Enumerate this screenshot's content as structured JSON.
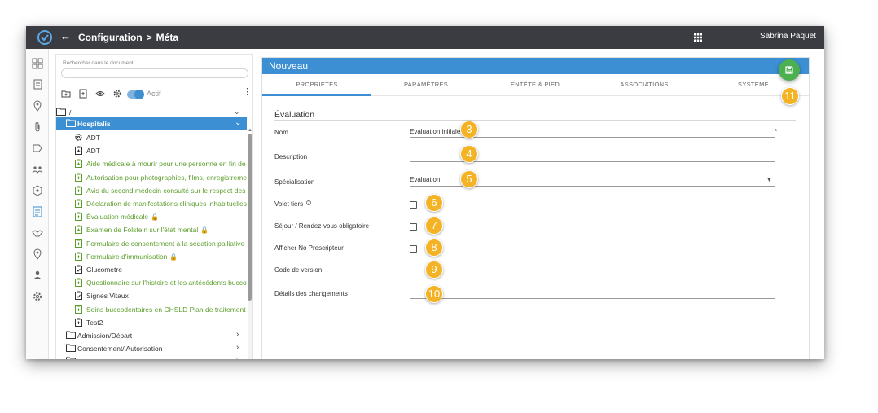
{
  "topbar": {
    "logo_icon": "check-circle-icon",
    "back_icon": "arrow-left-icon",
    "breadcrumb": [
      "Configuration",
      "Méta"
    ],
    "breadcrumb_separator": ">",
    "apps_icon": "grid-icon",
    "user_name": "Sabrina Paquet",
    "bg_color": "#3a3c42"
  },
  "rail": {
    "icons": [
      "dashboard-icon",
      "documents-icon",
      "location-pin-icon",
      "attachment-icon",
      "tag-icon",
      "people-icon",
      "module-icon",
      "forms-icon",
      "handshake-icon",
      "location-pin-icon",
      "user-admin-icon",
      "settings-icon"
    ]
  },
  "tree": {
    "search_label": "Rechercher dans le document",
    "search_value": "",
    "toolbar_icons": [
      "new-folder-icon",
      "new-document-icon",
      "eye-icon",
      "settings-icon"
    ],
    "active_toggle": {
      "label": "Actif",
      "on": true
    },
    "root_label": "/",
    "selected_folder": "Hospitalis",
    "documents": [
      {
        "label": "ADT",
        "type": "settings",
        "color": "dark",
        "locked": false
      },
      {
        "label": "ADT",
        "type": "form",
        "color": "dark",
        "locked": false
      },
      {
        "label": "Aide médicale à mourir pour une personne en fin de vie Cor",
        "type": "form-green",
        "color": "green",
        "locked": false
      },
      {
        "label": "Autorisation pour photographies, films, enregistrements so",
        "type": "form-green",
        "color": "green",
        "locked": false
      },
      {
        "label": "Avis du second médecin consulté sur le respect des condit",
        "type": "form-green",
        "color": "green",
        "locked": false
      },
      {
        "label": "Déclaration de manifestations cliniques inhabituelles après",
        "type": "form-green",
        "color": "green",
        "locked": false
      },
      {
        "label": "Évaluation médicale",
        "type": "form-green",
        "color": "green",
        "locked": true
      },
      {
        "label": "Examen de Folstein sur l'état mental",
        "type": "form-green",
        "color": "green",
        "locked": true
      },
      {
        "label": "Formulaire de consentement à la sédation palliative contin",
        "type": "form-green",
        "color": "green",
        "locked": false
      },
      {
        "label": "Formulaire d'immunisation",
        "type": "form-green",
        "color": "green",
        "locked": true
      },
      {
        "label": "Glucometre",
        "type": "checklist",
        "color": "dark",
        "locked": false
      },
      {
        "label": "Questionnaire sur l'histoire et les antécédents buccodentai",
        "type": "form-green",
        "color": "green",
        "locked": false
      },
      {
        "label": "Signes Vitaux",
        "type": "checklist",
        "color": "dark",
        "locked": false
      },
      {
        "label": "Soins buccodentaires en CHSLD Plan de traitement et évalu",
        "type": "form-green",
        "color": "green",
        "locked": false
      },
      {
        "label": "Test2",
        "type": "form",
        "color": "dark",
        "locked": false
      }
    ],
    "folders": [
      "Admission/Départ",
      "Consentement/ Autorisation",
      "Numérisation"
    ]
  },
  "form": {
    "header_title": "Nouveau",
    "header_color": "#3b8fd2",
    "tabs": [
      "PROPRIÉTÉS",
      "PARAMÈTRES",
      "ENTÊTE & PIED",
      "ASSOCIATIONS",
      "SYSTÈME"
    ],
    "active_tab": "PROPRIÉTÉS",
    "section_title": "Évaluation",
    "fields": {
      "nom": {
        "label": "Nom",
        "value": "Evaluation initiale",
        "required_mark": "*"
      },
      "description": {
        "label": "Description",
        "value": ""
      },
      "specialisation": {
        "label": "Spécialisation",
        "value": "Evaluation"
      },
      "volet_tiers": {
        "label": "Volet tiers",
        "checked": false
      },
      "sejour": {
        "label": "Séjour / Rendez-vous obligatoire",
        "checked": false
      },
      "afficher": {
        "label": "Afficher No Prescripteur",
        "checked": false
      },
      "code_version": {
        "label": "Code de version:",
        "value": ""
      },
      "details": {
        "label": "Détails des changements",
        "value": ""
      }
    },
    "save_icon": "save-icon",
    "save_color": "#4caf50"
  },
  "callouts": {
    "color": "#f4b324",
    "numbers": [
      "3",
      "4",
      "5",
      "6",
      "7",
      "8",
      "9",
      "10",
      "11"
    ]
  }
}
